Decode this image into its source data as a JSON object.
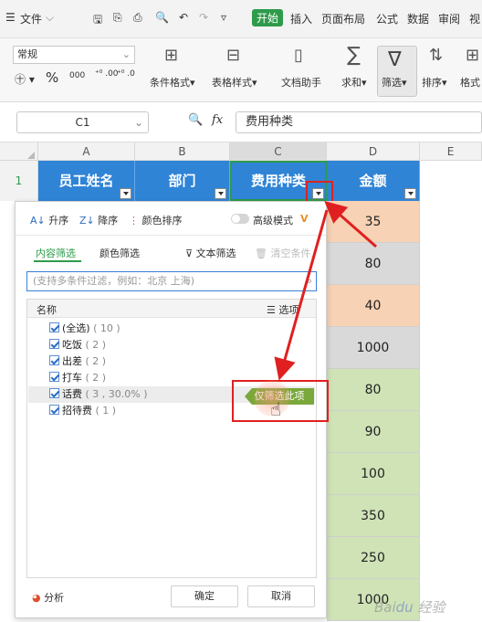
{
  "menubar": {
    "file": "文件",
    "tabs": [
      "开始",
      "插入",
      "页面布局",
      "公式",
      "数据",
      "审阅",
      "视"
    ]
  },
  "ribbon": {
    "number_format": "常规",
    "cond_format": "条件格式",
    "table_style": "表格样式",
    "doc_helper": "文档助手",
    "sum": "求和",
    "filter": "筛选",
    "sort": "排序",
    "format": "格式"
  },
  "formula_bar": {
    "cell_ref": "C1",
    "fx": "fx",
    "content": "费用种类"
  },
  "columns": [
    "A",
    "B",
    "C",
    "D",
    "E"
  ],
  "row_header": "1",
  "table": {
    "headers": [
      "员工姓名",
      "部门",
      "费用种类",
      "金额"
    ],
    "amounts": [
      "35",
      "80",
      "40",
      "1000",
      "80",
      "90",
      "100",
      "350",
      "250",
      "1000"
    ]
  },
  "filter_panel": {
    "sort_asc": "升序",
    "sort_desc": "降序",
    "color_sort": "颜色排序",
    "advanced_mode": "高级模式",
    "tab_content": "内容筛选",
    "tab_color": "颜色筛选",
    "text_filter": "文本筛选",
    "clear_filter": "清空条件",
    "search_placeholder": "(支持多条件过滤，例如：北京 上海)",
    "list_header_name": "名称",
    "list_header_options": "选项",
    "items": [
      {
        "label": "(全选)",
        "count": "( 10 )"
      },
      {
        "label": "吃饭",
        "count": "( 2 )"
      },
      {
        "label": "出差",
        "count": "( 2 )"
      },
      {
        "label": "打车",
        "count": "( 2 )"
      },
      {
        "label": "话费",
        "count": "( 3 , 30.0% )"
      },
      {
        "label": "招待费",
        "count": "( 1 )"
      }
    ],
    "only_filter_this": "仅筛选此项",
    "analysis": "分析",
    "ok": "确定",
    "cancel": "取消"
  },
  "colors": {
    "header_blue": "#2f84d6",
    "accent_green": "#2e9b4a",
    "highlight_red": "#e02020",
    "peach": "#f8d2b4",
    "gray": "#d9d9d9",
    "light_green": "#cfe3b7"
  }
}
